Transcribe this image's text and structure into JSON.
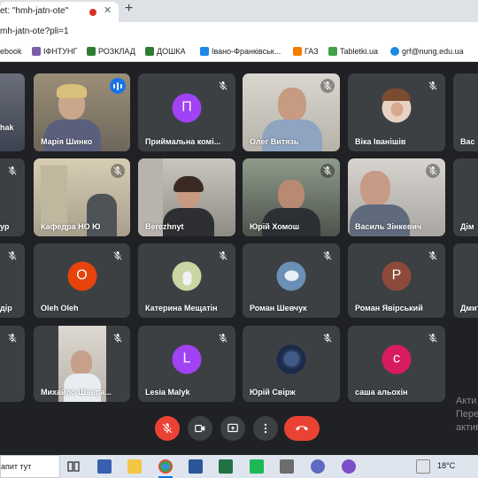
{
  "browser": {
    "tab_title": "et: \"hmh-jatn-ote\"",
    "url": "mh-jatn-ote?pli=1",
    "bookmarks": [
      {
        "label": "ebook",
        "color": "#3b5998"
      },
      {
        "label": "ІФНТУНГ",
        "color": "#7b5ea7"
      },
      {
        "label": "РОЗКЛАД",
        "color": "#2e7d32"
      },
      {
        "label": "ДОШКА",
        "color": "#2e7d32"
      },
      {
        "label": "Івано-Франківськ...",
        "color": "#1e88e5"
      },
      {
        "label": "ГАЗ",
        "color": "#f57c00"
      },
      {
        "label": "Tabletki.ua",
        "color": "#43a047"
      },
      {
        "label": "grf@nung.edu.ua",
        "color": "#1e88e5"
      }
    ]
  },
  "meet": {
    "tiles": [
      {
        "name": "hak",
        "avatar": "",
        "avatar_color": "",
        "muted": false,
        "video": true
      },
      {
        "name": "Марія Шинко",
        "avatar": "",
        "avatar_color": "",
        "muted": false,
        "video": true,
        "speaking": true
      },
      {
        "name": "Приймальна комі...",
        "avatar": "П",
        "avatar_color": "#a142f4",
        "muted": true,
        "video": false
      },
      {
        "name": "Олег Витязь",
        "avatar": "",
        "avatar_color": "",
        "muted": true,
        "video": true
      },
      {
        "name": "Віка Іванішів",
        "avatar": "photo",
        "avatar_color": "#e8c8b8",
        "muted": true,
        "video": false
      },
      {
        "name": "Вас",
        "avatar": "",
        "avatar_color": "",
        "muted": true,
        "video": false
      },
      {
        "name": "ур",
        "avatar": "",
        "avatar_color": "",
        "muted": true,
        "video": false
      },
      {
        "name": "Кафедра НО Ю",
        "avatar": "",
        "avatar_color": "",
        "muted": true,
        "video": true
      },
      {
        "name": "Berezhnyt",
        "avatar": "",
        "avatar_color": "",
        "muted": true,
        "video": true
      },
      {
        "name": "Юрій Хомош",
        "avatar": "",
        "avatar_color": "",
        "muted": true,
        "video": true
      },
      {
        "name": "Василь Зінкевич",
        "avatar": "",
        "avatar_color": "",
        "muted": true,
        "video": true
      },
      {
        "name": "Дім",
        "avatar": "",
        "avatar_color": "",
        "muted": false,
        "video": false
      },
      {
        "name": "дір",
        "avatar": "",
        "avatar_color": "",
        "muted": true,
        "video": false
      },
      {
        "name": "Oleh Oleh",
        "avatar": "O",
        "avatar_color": "#e8430a",
        "muted": true,
        "video": false
      },
      {
        "name": "Катерина Мещатін",
        "avatar": "photo",
        "avatar_color": "#c9d6a3",
        "muted": true,
        "video": false
      },
      {
        "name": "Роман Шевчук",
        "avatar": "photo",
        "avatar_color": "#6b8fb5",
        "muted": true,
        "video": false
      },
      {
        "name": "Роман Явірський",
        "avatar": "P",
        "avatar_color": "#8d4a3a",
        "muted": true,
        "video": false
      },
      {
        "name": "Дмит",
        "avatar": "",
        "avatar_color": "",
        "muted": false,
        "video": false
      },
      {
        "name": "",
        "avatar": "",
        "avatar_color": "",
        "muted": true,
        "video": false
      },
      {
        "name": "Михайло Шавра...",
        "avatar": "",
        "avatar_color": "",
        "muted": true,
        "video": true
      },
      {
        "name": "Lesia Malyk",
        "avatar": "L",
        "avatar_color": "#a142f4",
        "muted": true,
        "video": false
      },
      {
        "name": "Юрій Свірж",
        "avatar": "photo",
        "avatar_color": "#1a2a4a",
        "muted": true,
        "video": false
      },
      {
        "name": "саша альохін",
        "avatar": "с",
        "avatar_color": "#d81b60",
        "muted": true,
        "video": false
      }
    ],
    "watermark_line1": "Акти",
    "watermark_line2": "Пере",
    "watermark_line3": "актив"
  },
  "taskbar": {
    "search_text": "апит тут",
    "temperature": "18°C"
  },
  "colors": {
    "end_call": "#ea4335",
    "mic_off": "#ea4335",
    "control_bg": "#3c4043"
  }
}
